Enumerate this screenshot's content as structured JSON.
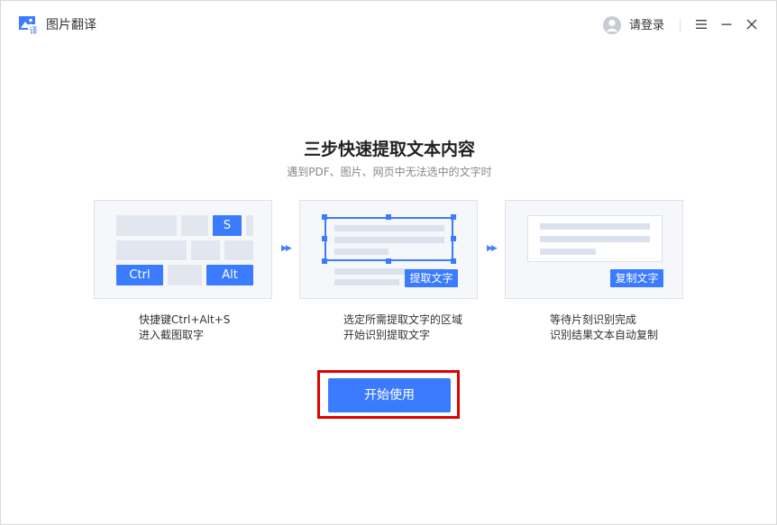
{
  "app": {
    "title": "图片翻译",
    "login_label": "请登录"
  },
  "heading": {
    "title": "三步快速提取文本内容",
    "subtitle": "遇到PDF、图片、网页中无法选中的文字时"
  },
  "steps": [
    {
      "keys": {
        "s": "S",
        "ctrl": "Ctrl",
        "alt": "Alt"
      },
      "desc_line1": "快捷键Ctrl+Alt+S",
      "desc_line2": "进入截图取字"
    },
    {
      "tag": "提取文字",
      "desc_line1": "选定所需提取文字的区域",
      "desc_line2": "开始识别提取文字"
    },
    {
      "tag": "复制文字",
      "desc_line1": "等待片刻识别完成",
      "desc_line2": "识别结果文本自动复制"
    }
  ],
  "arrows": {
    "glyph": "▶▶"
  },
  "start_button": {
    "label": "开始使用"
  },
  "colors": {
    "accent": "#3b7cff",
    "highlight": "#e00000"
  }
}
